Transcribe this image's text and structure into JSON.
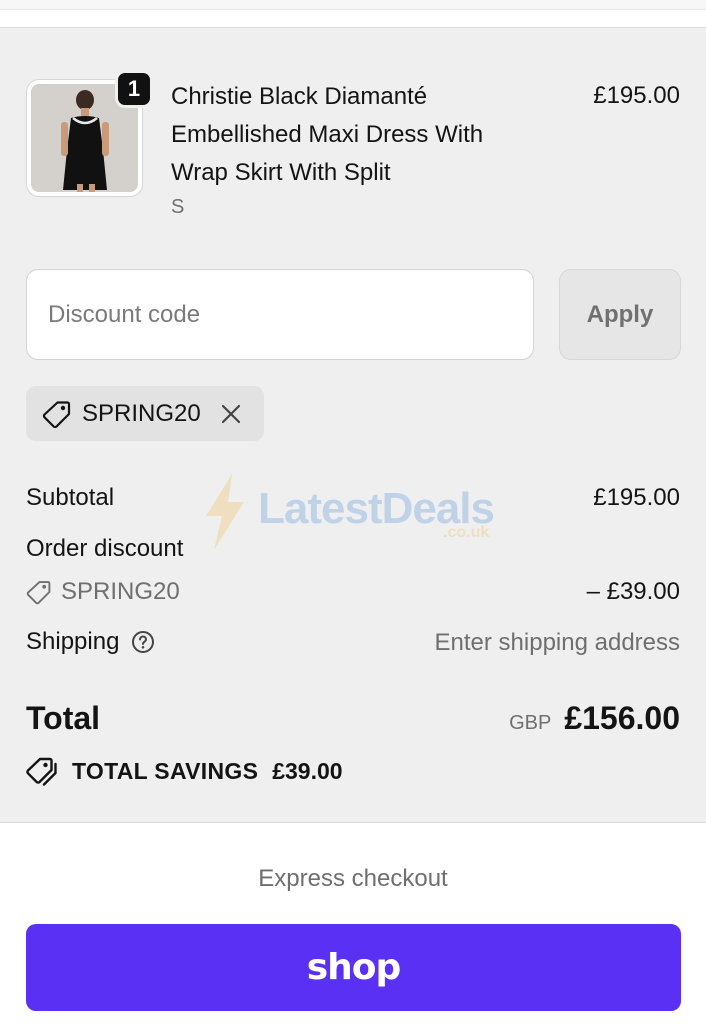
{
  "product": {
    "name": "Christie Black Diamanté Embellished Maxi Dress With Wrap Skirt With Split",
    "variant": "S",
    "price": "£195.00",
    "quantity": "1",
    "image_icon": "black-dress-thumbnail"
  },
  "discount": {
    "placeholder": "Discount code",
    "apply_label": "Apply",
    "applied_code": "SPRING20"
  },
  "summary": {
    "subtotal_label": "Subtotal",
    "subtotal_value": "£195.00",
    "order_discount_label": "Order discount",
    "discount_code": "SPRING20",
    "discount_value": "– £39.00",
    "shipping_label": "Shipping",
    "shipping_value": "Enter shipping address",
    "total_label": "Total",
    "currency": "GBP",
    "total_value": "£156.00",
    "savings_label": "TOTAL SAVINGS",
    "savings_value": "£39.00"
  },
  "watermark": {
    "text": "LatestDeals",
    "sub": ".co.uk"
  },
  "express": {
    "label": "Express checkout",
    "shop_label": "shop"
  },
  "colors": {
    "shop_purple": "#5a31f4",
    "summary_bg": "#efefef"
  }
}
